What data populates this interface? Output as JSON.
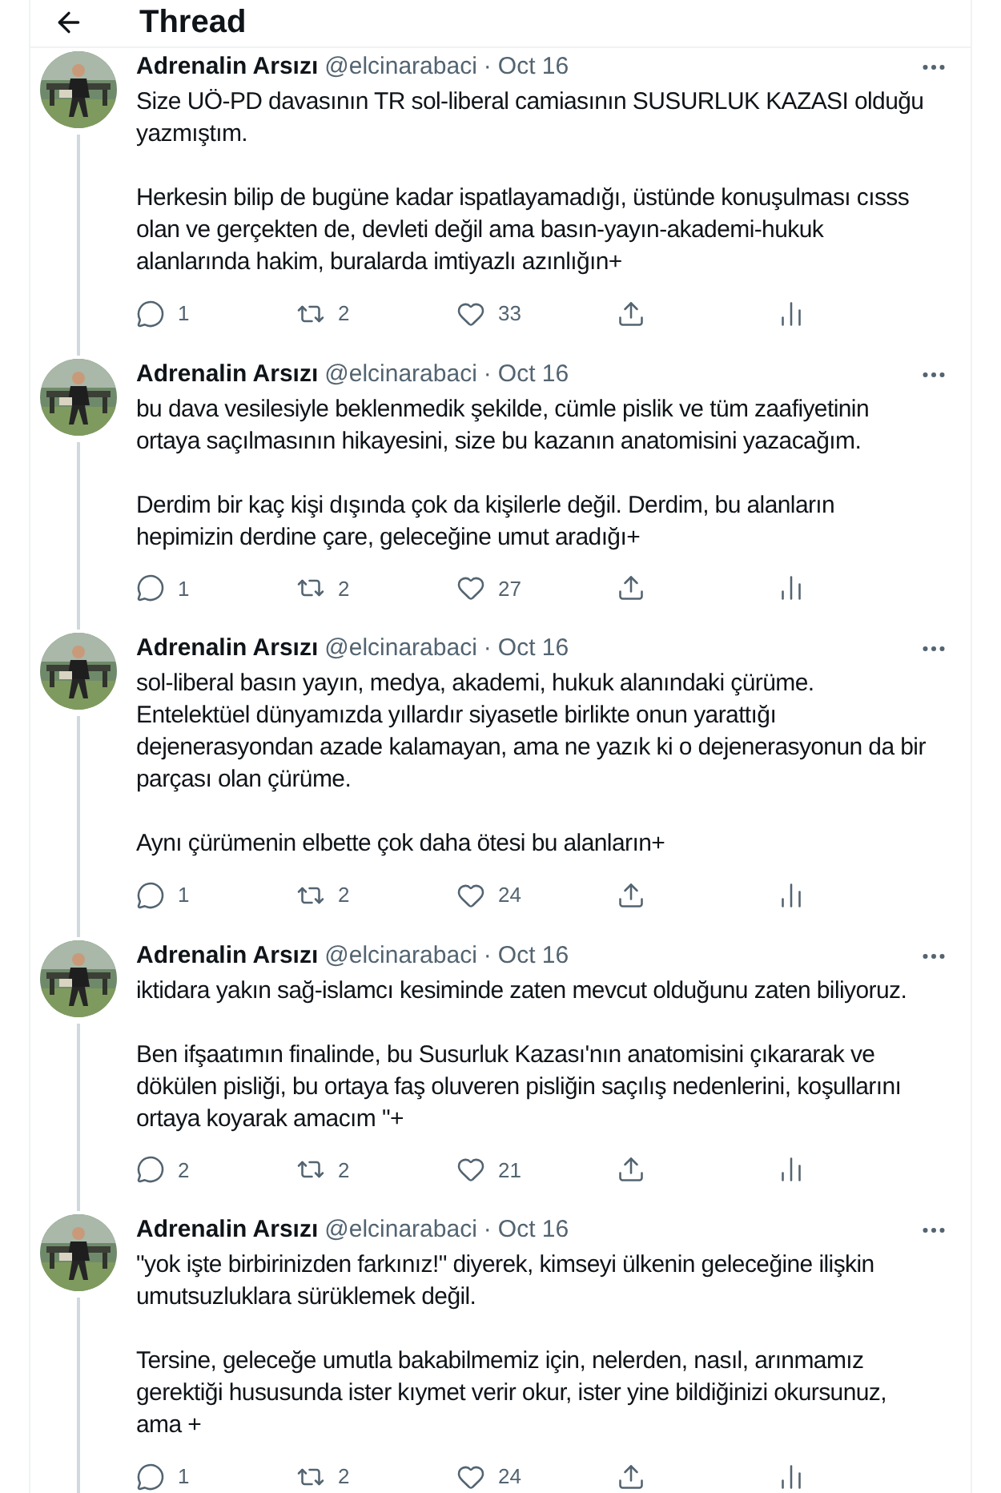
{
  "header": {
    "title": "Thread"
  },
  "tweets": [
    {
      "author": "Adrenalin Arsızı",
      "handle": "@elcinarabaci",
      "dot": "·",
      "date": "Oct 16",
      "paragraphs": [
        "Size UÖ-PD davasının TR sol-liberal camiasının SUSURLUK KAZASI olduğu yazmıştım.",
        "Herkesin bilip de bugüne kadar ispatlayamadığı, üstünde konuşulması cısss olan ve gerçekten de, devleti değil ama basın-yayın-akademi-hukuk alanlarında hakim, buralarda imtiyazlı azınlığın+"
      ],
      "replies": "1",
      "retweets": "2",
      "likes": "33"
    },
    {
      "author": "Adrenalin Arsızı",
      "handle": "@elcinarabaci",
      "dot": "·",
      "date": "Oct 16",
      "paragraphs": [
        "bu dava vesilesiyle beklenmedik şekilde, cümle pislik ve tüm zaafiyetinin ortaya saçılmasının hikayesini, size bu kazanın anatomisini yazacağım.",
        "Derdim bir kaç kişi dışında çok da kişilerle değil. Derdim, bu alanların hepimizin derdine çare, geleceğine umut aradığı+"
      ],
      "replies": "1",
      "retweets": "2",
      "likes": "27"
    },
    {
      "author": "Adrenalin Arsızı",
      "handle": "@elcinarabaci",
      "dot": "·",
      "date": "Oct 16",
      "paragraphs": [
        "sol-liberal basın yayın, medya, akademi, hukuk alanındaki çürüme. Entelektüel dünyamızda yıllardır siyasetle birlikte onun yarattığı dejenerasyondan azade kalamayan, ama ne yazık ki o dejenerasyonun da bir parçası olan çürüme.",
        "Aynı çürümenin elbette çok daha ötesi bu alanların+"
      ],
      "replies": "1",
      "retweets": "2",
      "likes": "24"
    },
    {
      "author": "Adrenalin Arsızı",
      "handle": "@elcinarabaci",
      "dot": "·",
      "date": "Oct 16",
      "paragraphs": [
        "iktidara yakın sağ-islamcı kesiminde zaten mevcut olduğunu zaten biliyoruz.",
        "Ben ifşaatımın finalinde, bu Susurluk Kazası'nın anatomisini çıkararak ve dökülen pisliği, bu ortaya faş oluveren pisliğin saçılış nedenlerini, koşullarını ortaya koyarak amacım \"+"
      ],
      "replies": "2",
      "retweets": "2",
      "likes": "21"
    },
    {
      "author": "Adrenalin Arsızı",
      "handle": "@elcinarabaci",
      "dot": "·",
      "date": "Oct 16",
      "paragraphs": [
        "\"yok işte birbirinizden farkınız!\" diyerek, kimseyi ülkenin geleceğine ilişkin umutsuzluklara sürüklemek değil.",
        "Tersine, geleceğe umutla bakabilmemiz için, nelerden, nasıl, arınmamız gerektiği hususunda ister kıymet verir okur, ister yine bildiğinizi okursunuz, ama +"
      ],
      "replies": "1",
      "retweets": "2",
      "likes": "24"
    }
  ]
}
